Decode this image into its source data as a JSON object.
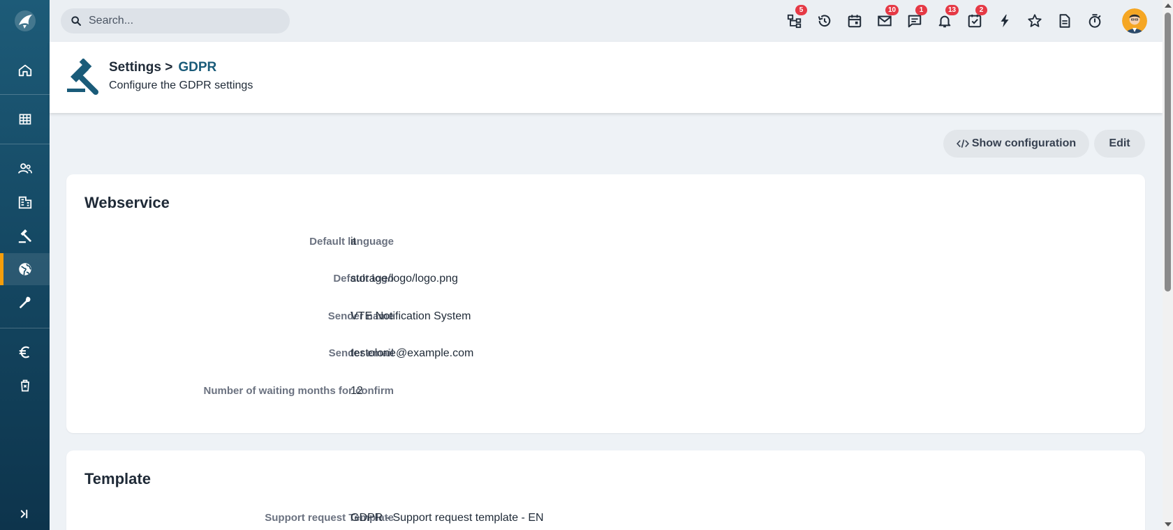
{
  "topbar": {
    "search_placeholder": "Search...",
    "icons": [
      {
        "name": "hierarchy-icon",
        "badge": "5"
      },
      {
        "name": "history-icon",
        "badge": ""
      },
      {
        "name": "calendar-icon",
        "badge": ""
      },
      {
        "name": "mail-icon",
        "badge": "10"
      },
      {
        "name": "chat-icon",
        "badge": "1"
      },
      {
        "name": "bell-icon",
        "badge": "13"
      },
      {
        "name": "tasks-icon",
        "badge": "2"
      },
      {
        "name": "lightning-icon",
        "badge": ""
      },
      {
        "name": "star-icon",
        "badge": ""
      },
      {
        "name": "document-icon",
        "badge": ""
      },
      {
        "name": "timer-icon",
        "badge": ""
      }
    ],
    "badge_color": "#e53945"
  },
  "sidebar": {
    "items": [
      "home-icon",
      "grid-icon",
      "contacts-icon",
      "building-icon",
      "gavel-icon",
      "globe-icon",
      "wrench-icon",
      "euro-icon",
      "recycle-bin-icon"
    ],
    "active": "globe-icon",
    "accent_color": "#f59e0b",
    "expand": "expand-sidebar-icon"
  },
  "header": {
    "breadcrumb_root": "Settings >",
    "breadcrumb_current": "GDPR",
    "subtitle": "Configure the GDPR settings"
  },
  "actions": {
    "show_configuration": "Show configuration",
    "edit": "Edit"
  },
  "webservice": {
    "title": "Webservice",
    "rows": [
      {
        "label": "Default language",
        "value": "it"
      },
      {
        "label": "Default logo",
        "value": "storage/logo/logo.png"
      },
      {
        "label": "Sender name",
        "value": "VTE Notification System"
      },
      {
        "label": "Sender email",
        "value": "testolone@example.com"
      },
      {
        "label": "Number of waiting months for confirm",
        "value": "12"
      }
    ]
  },
  "template": {
    "title": "Template",
    "rows": [
      {
        "label": "Support request Template",
        "value": "GDPR - Support request template - EN"
      }
    ]
  }
}
